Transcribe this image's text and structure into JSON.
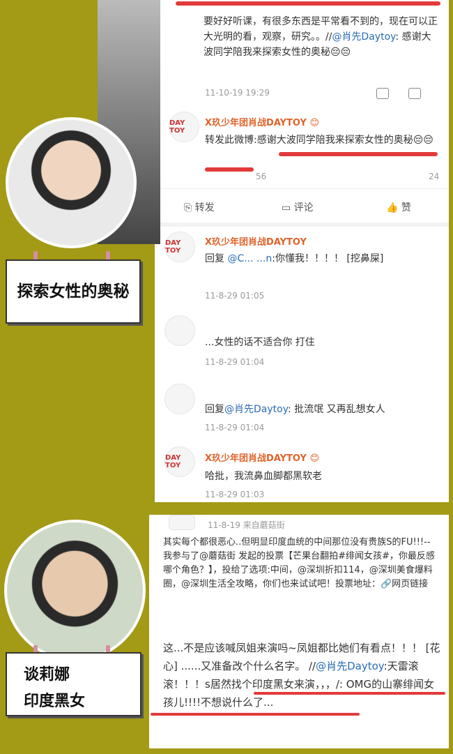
{
  "post1": {
    "text": "要好好听课，有很多东西是平常看不到的，现在可以正大光明的看，观察，研究。。//",
    "mention": "@肖先Daytoy",
    "text_after": ": 感谢大波同学陪我来探索女性的奥秘😔😔",
    "time": "11-10-19 19:29"
  },
  "post2": {
    "name": "X玖少年团肖战DAYTOY 😊",
    "avatar_text": "DAY TOY",
    "text": "转发此微博:感谢大波同学陪我来探索女性的奥秘😔😔",
    "time": "56",
    "like_count": "24"
  },
  "actions": {
    "repost": "转发",
    "comment": "评论",
    "like": "赞"
  },
  "comments": [
    {
      "name": "X玖少年团肖战DAYTOY",
      "avatar_text": "DAY TOY",
      "text_pre": "回复 ",
      "mention": "@C... ...n",
      "text": ":你懂我！！！！ [挖鼻屎]",
      "time": "11-8-29 01:05"
    },
    {
      "name": "",
      "avatar_text": "",
      "text_pre": "",
      "mention": "",
      "text": "...女性的话不适合你   打住",
      "time": "11-8-29 01:04"
    },
    {
      "name": "",
      "avatar_text": "",
      "text_pre": "回复",
      "mention": "@肖先Daytoy",
      "text": ": 批流氓 又再乱想女人",
      "time": "11-8-29 01:04"
    },
    {
      "name": "X玖少年团肖战DAYTOY 😊",
      "avatar_text": "DAY TOY",
      "text_pre": "",
      "mention": "",
      "text": "哈批，我流鼻血脚都黑软老",
      "time": "11-8-29 01:03"
    }
  ],
  "label1": "探索女性的奥秘",
  "label2_line1": "谈莉娜",
  "label2_line2": "印度黑女",
  "lower_post": {
    "meta": "11-8-19  来自蘑菇街",
    "para1": "其实每个都很恶心..但明显印度血统的中间那位没有贵族S的FU!!!-- 我参与了@蘑菇街 发起的投票【芒果台翻拍#绯闻女孩#，你最反感哪个角色？】，投给了选项:中间，@深圳折扣114，@深圳美食爆料圈，@深圳生活全攻略，你们也来试试吧！投票地址：🔗网页链接",
    "para2_a": "这...不是应该喊凤姐来演吗~凤姐都比她们有看点！！！ [花心] ......又准备改个什么名字。 //",
    "para2_mention": "@肖先Daytoy",
    "para2_b": ":天雷滚滚！！！s居然找个印度黑女来演，，，/",
    "para2_c": ": OMG的山寨绯闻女孩儿!!!!不想说什么了..."
  },
  "colors": {
    "background": "#a39a16",
    "accent_red": "#e23b3b",
    "name_orange": "#e0642a",
    "link_blue": "#2a6db3"
  }
}
